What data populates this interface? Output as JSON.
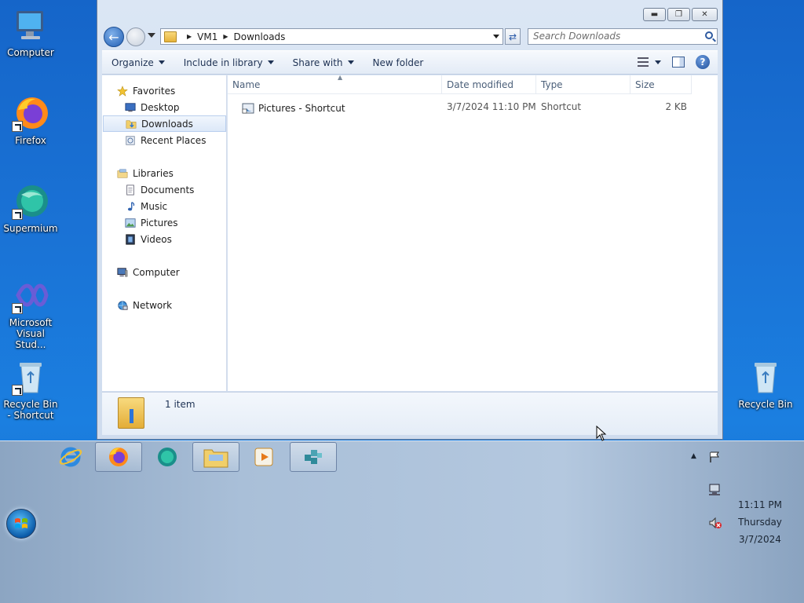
{
  "desktop": {
    "icons_left": [
      {
        "label": "Computer",
        "icon": "computer-icon"
      },
      {
        "label": "Firefox",
        "icon": "firefox-icon"
      },
      {
        "label": "Supermium",
        "icon": "supermium-icon"
      },
      {
        "label": "Microsoft Visual Stud...",
        "icon": "visual-studio-icon"
      },
      {
        "label": "Recycle Bin - Shortcut",
        "icon": "recycle-bin-icon"
      }
    ],
    "icons_right": [
      {
        "label": "Recycle Bin",
        "icon": "recycle-bin-icon"
      }
    ]
  },
  "explorer": {
    "breadcrumb": [
      "VM1",
      "Downloads"
    ],
    "search_placeholder": "Search Downloads",
    "toolbar": {
      "organize": "Organize",
      "include_in_library": "Include in library",
      "share_with": "Share with",
      "new_folder": "New folder"
    },
    "nav": {
      "favorites": "Favorites",
      "desktop": "Desktop",
      "downloads": "Downloads",
      "recent_places": "Recent Places",
      "libraries": "Libraries",
      "documents": "Documents",
      "music": "Music",
      "pictures": "Pictures",
      "videos": "Videos",
      "computer": "Computer",
      "network": "Network"
    },
    "columns": {
      "name": "Name",
      "date_modified": "Date modified",
      "type": "Type",
      "size": "Size"
    },
    "files": [
      {
        "name": "Pictures - Shortcut",
        "date_modified": "3/7/2024 11:10 PM",
        "type": "Shortcut",
        "size": "2 KB"
      }
    ],
    "details": {
      "count": "1 item"
    }
  },
  "taskbar": {
    "apps": [
      "internet-explorer-icon",
      "firefox-icon",
      "supermium-icon",
      "file-explorer-icon",
      "media-player-icon",
      "registry-editor-icon"
    ],
    "clock": {
      "time": "11:11 PM",
      "day": "Thursday",
      "date": "3/7/2024"
    }
  },
  "colors": {
    "accent": "#1a73d6",
    "selection": "#dce8f8"
  }
}
